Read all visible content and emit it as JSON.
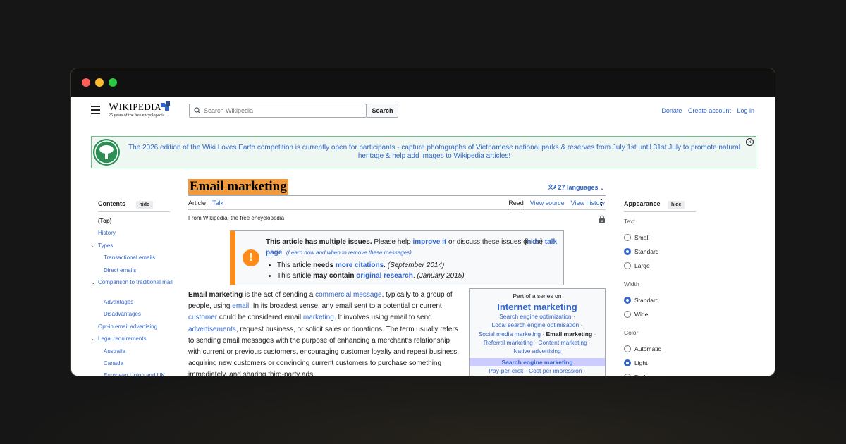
{
  "header": {
    "logo_word_first": "W",
    "logo_word_rest": "IKIPEDIA",
    "logo_tagline": "25 years of the free encyclopedia",
    "search_placeholder": "Search Wikipedia",
    "search_button": "Search",
    "links": [
      "Donate",
      "Create account",
      "Log in"
    ]
  },
  "banner": {
    "text": "The 2026 edition of the Wiki Loves Earth competition is currently open for participants - capture photographs of Vietnamese national parks & reserves from July 1st until 31st July to promote natural heritage & help add images to Wikipedia articles!"
  },
  "article": {
    "title": "Email marketing",
    "languages": "27 languages",
    "tab_article": "Article",
    "tab_talk": "Talk",
    "tab_read": "Read",
    "tab_view_source": "View source",
    "tab_view_history": "View history",
    "from": "From Wikipedia, the free encyclopedia"
  },
  "toc": {
    "title": "Contents",
    "hide": "hide",
    "items": [
      {
        "label": "(Top)",
        "level": 0
      },
      {
        "label": "History",
        "level": 0
      },
      {
        "label": "Types",
        "level": 0
      },
      {
        "label": "Transactional emails",
        "level": 1
      },
      {
        "label": "Direct emails",
        "level": 1
      },
      {
        "label": "Comparison to traditional mail",
        "level": 0
      },
      {
        "label": "Advantages",
        "level": 1
      },
      {
        "label": "Disadvantages",
        "level": 1
      },
      {
        "label": "Opt-in email advertising",
        "level": 0
      },
      {
        "label": "Legal requirements",
        "level": 0
      },
      {
        "label": "Australia",
        "level": 1
      },
      {
        "label": "Canada",
        "level": 1
      },
      {
        "label": "European Union and UK",
        "level": 1
      }
    ]
  },
  "issues": {
    "lead_bold": "This article has multiple issues.",
    "lead_1": " Please help ",
    "improve": "improve it",
    "lead_2": " or discuss these issues on the ",
    "talk_page": "talk page",
    "learn": "(Learn how and when to remove these messages)",
    "hide": "hide",
    "item1_pre": "This article ",
    "item1_bold": "needs",
    "item1_link": "more citations",
    "item1_date": "(September 2014)",
    "item2_pre": "This article ",
    "item2_bold": "may contain",
    "item2_link": "original research",
    "item2_date": "(January 2015)"
  },
  "body": {
    "bold": "Email marketing",
    "t1": " is the act of sending a ",
    "l1": "commercial message",
    "t2": ", typically to a group of people, using ",
    "l2": "email",
    "t3": ". In its broadest sense, any email sent to a potential or current ",
    "l3": "customer",
    "t4": " could be considered email ",
    "l4": "marketing",
    "t5": ". It involves using email to send ",
    "l5": "advertisements",
    "t6": ", request business, or solicit sales or donations. The term usually refers to sending email messages with the purpose of enhancing a merchant's relationship with current or previous customers, encouraging customer loyalty and repeat business, acquiring new customers or convincing current customers to purchase something immediately, and sharing third-party ads."
  },
  "infobox": {
    "part_of": "Part of a series on",
    "title": "Internet marketing",
    "l1": "Search engine optimization",
    "l2": "Local search engine optimisation",
    "l3": "Social media marketing",
    "l3b": "Email marketing",
    "l4a": "Referral marketing",
    "l4b": "Content marketing",
    "l5": "Native advertising",
    "head": "Search engine marketing",
    "l6a": "Pay-per-click",
    "l6b": "Cost per impression"
  },
  "appearance": {
    "title": "Appearance",
    "hide": "hide",
    "text_label": "Text",
    "text_options": [
      "Small",
      "Standard",
      "Large"
    ],
    "text_selected": "Standard",
    "width_label": "Width",
    "width_options": [
      "Standard",
      "Wide"
    ],
    "width_selected": "Standard",
    "color_label": "Color",
    "color_options": [
      "Automatic",
      "Light",
      "Dark"
    ],
    "color_selected": "Light"
  }
}
